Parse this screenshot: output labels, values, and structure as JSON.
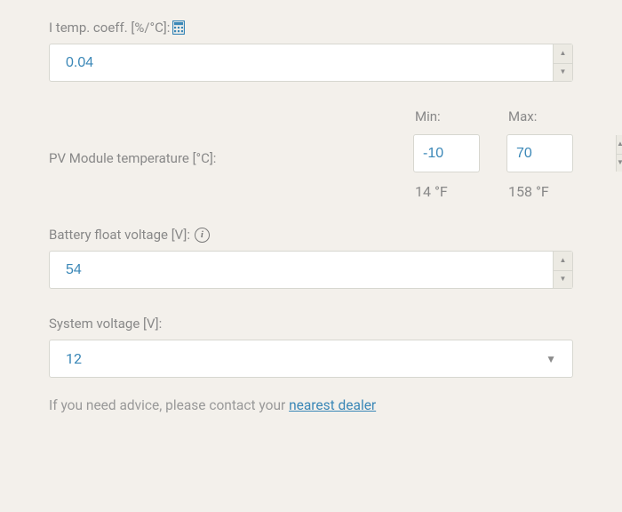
{
  "fields": {
    "i_temp_coeff": {
      "label": "I temp. coeff. [%/°C]:",
      "value": "0.04"
    },
    "pv_temp": {
      "label": "PV Module temperature [°C]:",
      "min_label": "Min:",
      "max_label": "Max:",
      "min_value": "-10",
      "max_value": "70",
      "min_f": "14 °F",
      "max_f": "158 °F"
    },
    "float_voltage": {
      "label": "Battery float voltage [V]:",
      "value": "54"
    },
    "system_voltage": {
      "label": "System voltage [V]:",
      "value": "12"
    }
  },
  "advice": {
    "text": "If you need advice, please contact your ",
    "link_text": "nearest dealer"
  },
  "glyphs": {
    "up": "▲",
    "down": "▼",
    "caret_down": "▼",
    "info": "i"
  }
}
